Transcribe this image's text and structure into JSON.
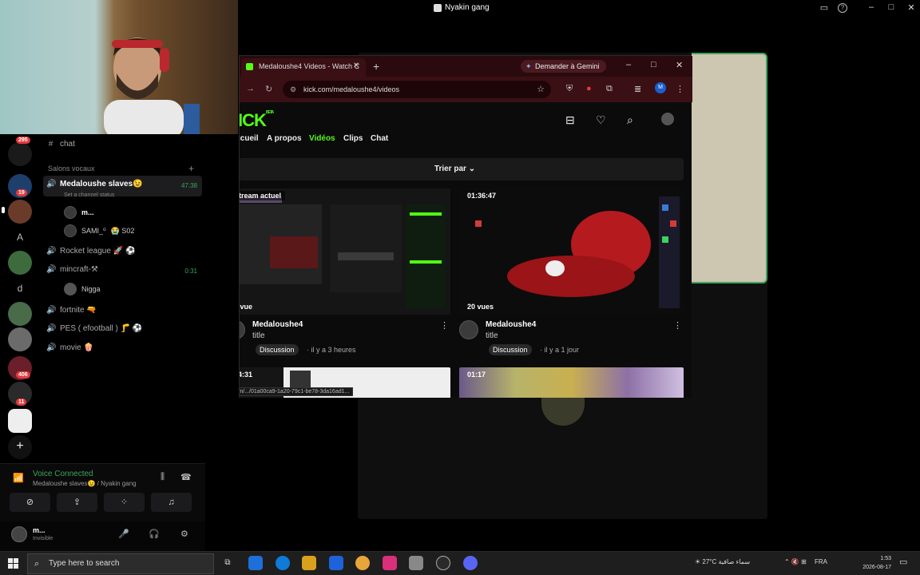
{
  "discord": {
    "window_title": "Nyakin gang",
    "channels": {
      "chat": "chat",
      "category": "Salons vocaux",
      "active_channel": "Medaloushe slaves😉",
      "active_channel_time": "47:38",
      "active_channel_status": "Set a channel status",
      "user1": "m...",
      "user2": "SAMI_⁰",
      "user2_badge": "😭 S02",
      "rocket": "Rocket league 🚀 ⚽",
      "mincraft": "mincraft-⚒",
      "mincraft_time": "0:31",
      "mincraft_user": "Nigga",
      "fortnite": "fortnite 🔫",
      "pes": "PES ( efootball ) 🦵 ⚽",
      "movie": "movie 🍿"
    },
    "rail_badges": [
      "295",
      "19",
      "406",
      "11"
    ],
    "rail_letters": [
      "A",
      "d"
    ],
    "voice": {
      "status": "Voice Connected",
      "location": "Medaloushe slaves😉 / Nyakin gang"
    },
    "user": {
      "name": "m...",
      "status": "Invisible"
    }
  },
  "chrome": {
    "tab_title": "Medaloushe4 Videos - Watch C",
    "gemini_label": "Demander à Gemini",
    "url": "kick.com/medaloushe4/videos",
    "profile_initial": "M",
    "status_url": "kick.com/.../01a00ca9-1a20-79c1-be78-3da16ad1..."
  },
  "kick": {
    "logo": "ICK",
    "logo_beta": "BETA",
    "nav": [
      "Accueil",
      "A propos",
      "Vidéos",
      "Clips",
      "Chat"
    ],
    "nav_active": "Vidéos",
    "sort_label": "Trier par",
    "videos": [
      {
        "badge": "Stream actuel",
        "views": "0 vue",
        "channel": "Medaloushe4",
        "title": "title",
        "category": "Discussion",
        "ago": "· il y a 3 heures"
      },
      {
        "badge": "01:36:47",
        "views": "20 vues",
        "channel": "Medaloushe4",
        "title": "title",
        "category": "Discussion",
        "ago": "· il y a 1 jour"
      },
      {
        "badge": "04:31"
      },
      {
        "badge": "01:17"
      }
    ]
  },
  "taskbar": {
    "search_placeholder": "Type here to search",
    "weather": "27°C  سماء صافية",
    "language": "FRA",
    "time": "1:53",
    "date": "2026-08-17"
  },
  "colors": {
    "kick_green": "#53fc18",
    "discord_green": "#3ba55d",
    "badge_red": "#e23b3b"
  }
}
